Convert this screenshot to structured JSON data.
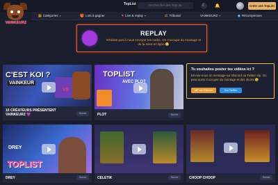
{
  "brand": {
    "logo_text": "VAINKEURZ",
    "site_name": "TopList"
  },
  "search": {
    "placeholder": "Rechercher des TopList..."
  },
  "header": {
    "enter_button": "Créer une TopList"
  },
  "nav": {
    "items": [
      {
        "label": "Catégories",
        "icon": "grid-icon",
        "has_dropdown": true
      },
      {
        "label": "Lots à gagner",
        "icon": "gift-icon",
        "has_dropdown": false
      },
      {
        "label": "Live & replay",
        "icon": "heart-icon",
        "has_dropdown": true
      },
      {
        "label": "Tribunal",
        "icon": "gavel-icon",
        "has_dropdown": false
      },
      {
        "label": "VAINKEURZ",
        "icon": "",
        "has_dropdown": true
      },
      {
        "label": "Récompenses",
        "icon": "diamond-icon",
        "has_dropdown": false
      }
    ]
  },
  "replay": {
    "title": "REPLAY",
    "subtitle": "N'hésite pas à nous envoyer tes rushs. On s'occupe du montage et de la mise en ligne 🙂"
  },
  "cta": {
    "title": "Tu souhaites poster tes vidéos ici ?",
    "text": "Envoie-nous un message sur Discord ou Twitter stp. On peut aussi s'occuper du montage et des shorts 😉",
    "discord_button": "MP sur Discord",
    "twitter_button": "Sur Twitter"
  },
  "cards": [
    {
      "name": "10 CRÉATEURS PRÉSENTENT VAINKEURZ 💜",
      "follow": "Suivre",
      "overlay": "C'EST KOI ?",
      "overlay2": "VAINKEUR",
      "overlay3": "VS"
    },
    {
      "name": "PLOT",
      "follow": "Suivre",
      "overlay": "TOPLIST",
      "overlay2": "AVEC PLOT"
    },
    {
      "name": "DREY",
      "follow": "Suivre",
      "overlay": "TOPLIST",
      "overlay2": "DREY"
    },
    {
      "name": "CELETIK",
      "follow": "Suivre"
    },
    {
      "name": "CHOOP CHOOP",
      "follow": "Suivre"
    }
  ],
  "colors": {
    "background": "#1a1d2b",
    "replay_border": "#ff5a2c",
    "cta_border": "#f2c14b",
    "accent_orange": "#ff9f3b",
    "twitter_blue": "#2f8fe0"
  }
}
